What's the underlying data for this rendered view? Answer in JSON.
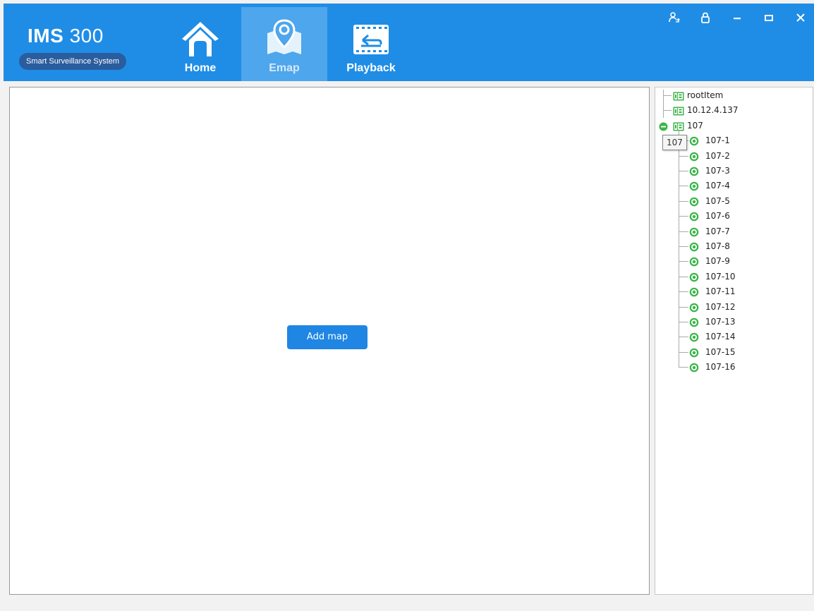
{
  "app": {
    "logo_main": "IMS",
    "logo_num": "300",
    "logo_subtitle": "Smart Surveillance System"
  },
  "nav": [
    {
      "label": "Home",
      "icon": "home-icon",
      "active": false
    },
    {
      "label": "Emap",
      "icon": "map-pin-icon",
      "active": true
    },
    {
      "label": "Playback",
      "icon": "playback-icon",
      "active": false
    }
  ],
  "window_controls": [
    {
      "name": "user-switch-icon",
      "glyph": "⚇"
    },
    {
      "name": "lock-icon",
      "glyph": "🔒"
    },
    {
      "name": "minimize-icon",
      "glyph": "—"
    },
    {
      "name": "maximize-icon",
      "glyph": "▭"
    },
    {
      "name": "close-icon",
      "glyph": "✕"
    }
  ],
  "map": {
    "add_map_label": "Add map"
  },
  "tree": {
    "top_nodes": [
      {
        "label": "rootItem",
        "type": "group"
      },
      {
        "label": "10.12.4.137",
        "type": "group"
      },
      {
        "label": "107",
        "type": "group",
        "expanded": true
      }
    ],
    "children": [
      "107-1",
      "107-2",
      "107-3",
      "107-4",
      "107-5",
      "107-6",
      "107-7",
      "107-8",
      "107-9",
      "107-10",
      "107-11",
      "107-12",
      "107-13",
      "107-14",
      "107-15",
      "107-16"
    ],
    "tooltip": "107"
  },
  "colors": {
    "header": "#1f8de6",
    "active_tab": "#4ea6ec",
    "button": "#1f86e3",
    "node_green": "#3db54a"
  }
}
